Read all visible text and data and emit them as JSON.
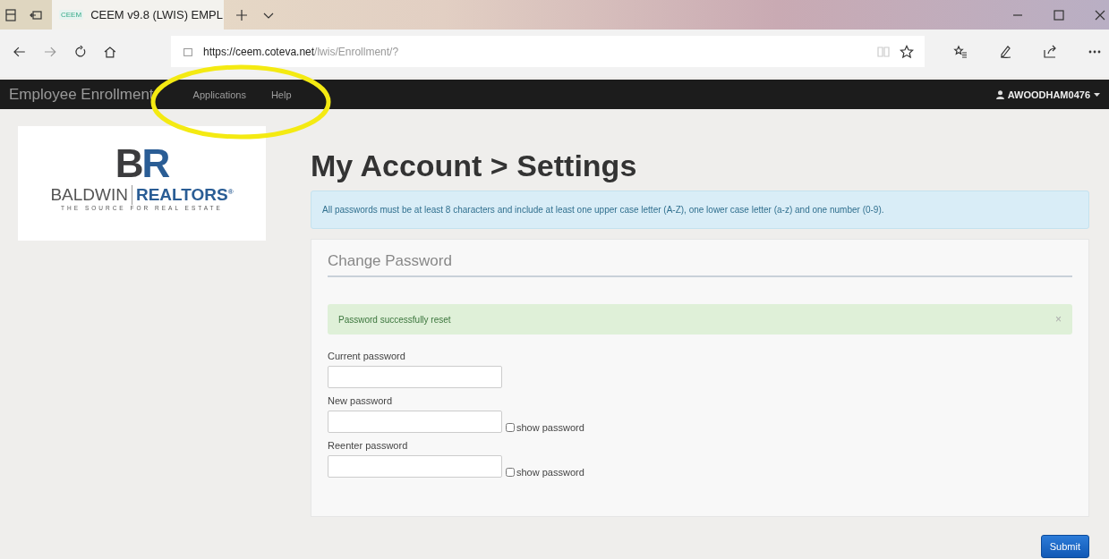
{
  "browser": {
    "tabs": [
      {
        "favicon": "CEEM",
        "title": "CEEM v9.8 (LWIS) EMPL",
        "selected": true
      }
    ],
    "url_host": "https://ceem.coteva.net",
    "url_path": "/lwis/Enrollment/?"
  },
  "navbar": {
    "brand": "Employee Enrollment",
    "links": [
      "Applications",
      "Help"
    ],
    "user": "AWOODHAM0476"
  },
  "logo": {
    "mark_1": "B",
    "mark_2": "R",
    "name_1": "BALDWIN",
    "name_2": "REALTORS",
    "registered": "®",
    "tagline": "THE SOURCE FOR REAL ESTATE"
  },
  "page": {
    "title": "My Account > Settings",
    "info": "All passwords must be at least 8 characters and include at least one upper case letter (A-Z), one lower case letter (a-z) and one number (0-9).",
    "form": {
      "legend": "Change Password",
      "alert": {
        "text": "Password successfully reset",
        "close": "×"
      },
      "fields": [
        {
          "label": "Current password"
        },
        {
          "label": "New password",
          "toggle": {
            "label": "show password",
            "checked": false
          }
        },
        {
          "label": "Reenter password",
          "toggle": {
            "label": "show password",
            "checked": false
          }
        }
      ]
    },
    "submit": "Submit"
  },
  "annotation": {
    "kind": "ellipse"
  }
}
